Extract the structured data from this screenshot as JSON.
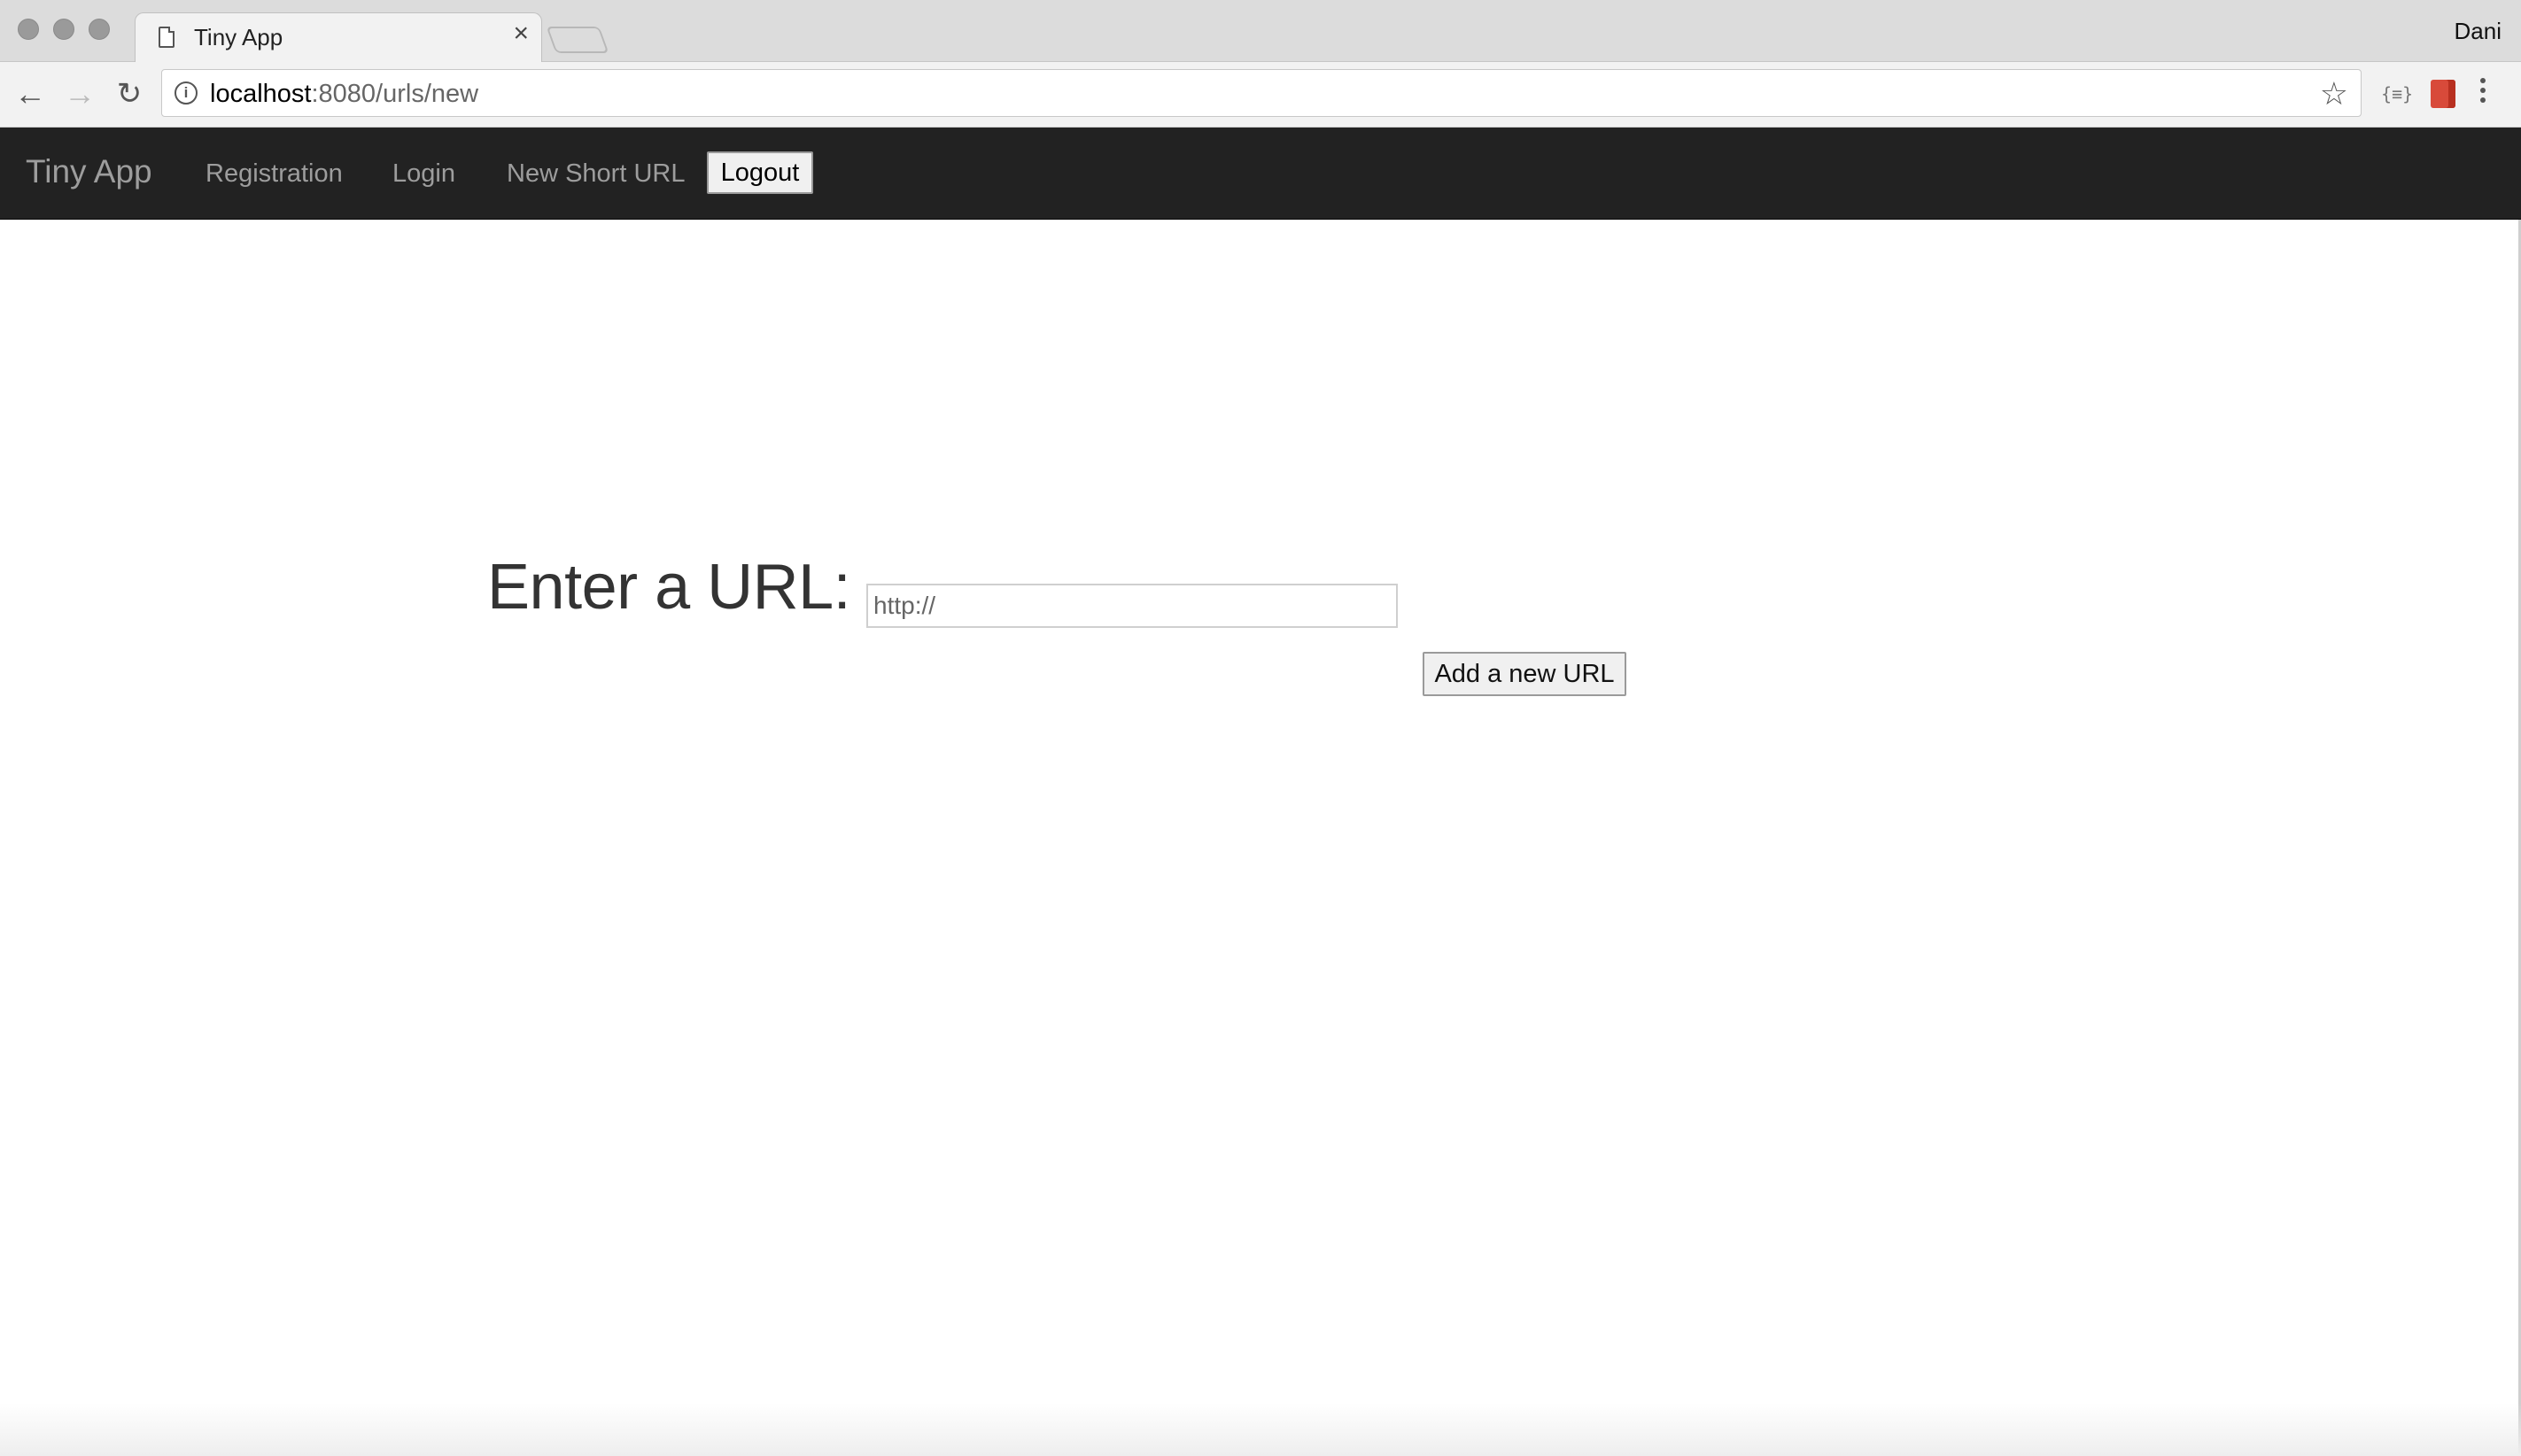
{
  "browser": {
    "tab_title": "Tiny App",
    "tab_close": "×",
    "profile_name": "Dani",
    "url_host": "localhost",
    "url_rest": ":8080/urls/new"
  },
  "icons": {
    "back": "arrow-left-icon",
    "forward": "arrow-right-icon",
    "reload": "reload-icon",
    "info": "info-icon",
    "star": "star-icon",
    "menu": "kebab-menu-icon"
  },
  "navbar": {
    "brand": "Tiny App",
    "links": [
      "Registration",
      "Login",
      "New Short URL"
    ],
    "logout_label": "Logout",
    "background": "#222222",
    "link_color": "#9d9d9d"
  },
  "main": {
    "heading": "Enter a URL:",
    "input_placeholder": "http://",
    "submit_label": "Add a new URL"
  }
}
